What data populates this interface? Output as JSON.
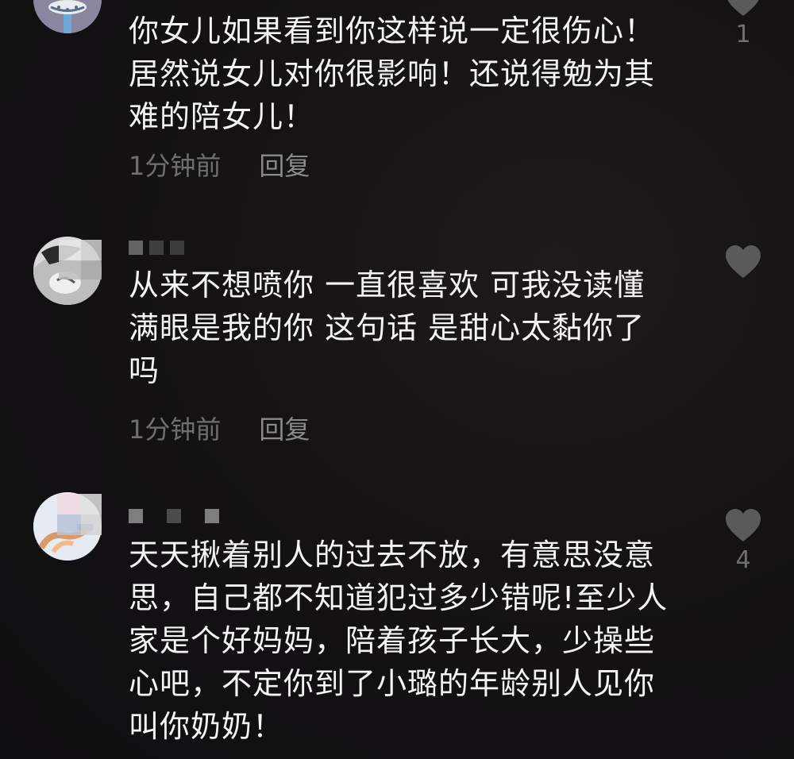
{
  "comments": [
    {
      "text": "你女儿如果看到你这样说一定很伤心！\n居然说女儿对你很影响！还说得勉为其\n难的陪女儿！",
      "time": "1分钟前",
      "reply": "回复",
      "likes": "1"
    },
    {
      "text": "从来不想喷你 一直很喜欢 可我没读懂\n满眼是我的你 这句话 是甜心太黏你了\n吗",
      "time": "1分钟前",
      "reply": "回复",
      "likes": ""
    },
    {
      "text": "天天揪着别人的过去不放，有意思没意\n思，自己都不知道犯过多少错呢!至少人\n家是个好妈妈，陪着孩子长大，少操些\n心吧，不定你到了小璐的年龄别人见你\n叫你奶奶！",
      "time": "",
      "reply": "",
      "likes": "4"
    }
  ],
  "icons": {
    "like": "heart-icon"
  },
  "colors": {
    "background": "#141213",
    "text": "#f4f4f4",
    "meta": "#6f6f6f",
    "heart": "#5a5a5a"
  }
}
